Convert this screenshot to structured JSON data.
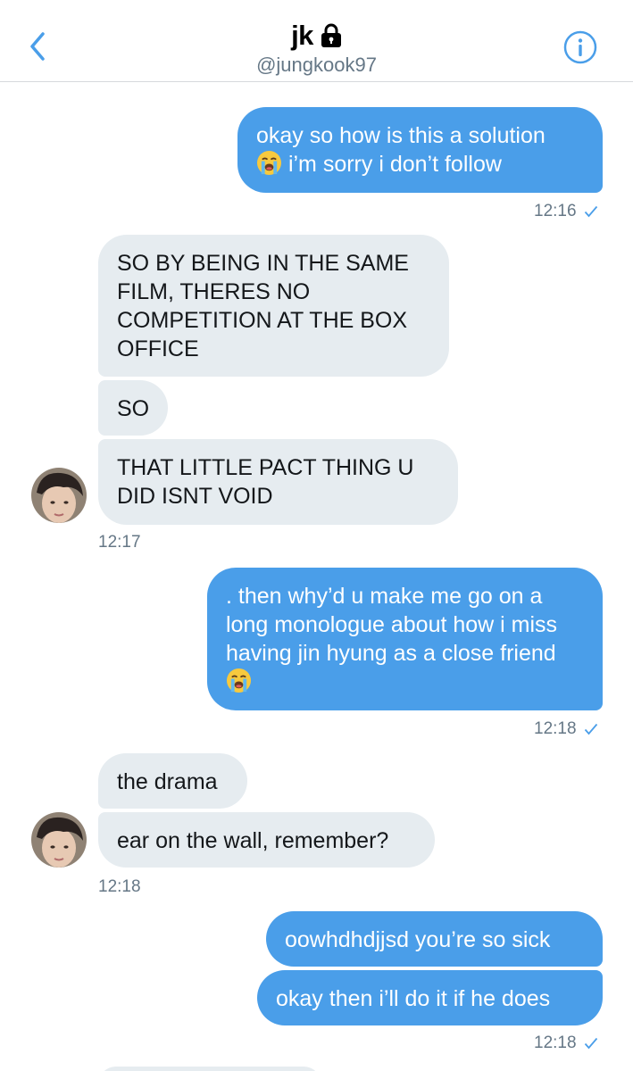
{
  "header": {
    "title": "jk",
    "handle": "@jungkook97",
    "back_icon": "chevron-left-icon",
    "lock_icon": "lock-icon",
    "info_icon": "info-icon",
    "accent_color": "#4a9ee9"
  },
  "messages": {
    "m1": {
      "text": "okay so how is this a solution",
      "text2": "i’m sorry i don’t follow",
      "emoji": "loudly-crying-face-icon"
    },
    "t1": "12:16",
    "m2": {
      "text": "SO BY BEING IN THE SAME FILM, THERES NO COMPETITION AT THE BOX OFFICE"
    },
    "m3": {
      "text": "SO"
    },
    "m4": {
      "text": "THAT LITTLE PACT THING U DID ISNT VOID"
    },
    "t2": "12:17",
    "m5": {
      "text": ". then why’d u make me go on a long monologue about how i miss having jin hyung as a close friend",
      "emoji": "loudly-crying-face-icon"
    },
    "t3": "12:18",
    "m6": {
      "text": "the drama"
    },
    "m7": {
      "text": "ear on the wall, remember?"
    },
    "t4": "12:18",
    "m8": {
      "text": "oowhdhdjjsd you’re so sick"
    },
    "m9": {
      "text": "okay then i’ll do it if he does"
    },
    "t5": "12:18"
  },
  "colors": {
    "sent_bubble": "#4a9ee9",
    "received_bubble": "#e6ecf0",
    "timestamp": "#657786"
  }
}
